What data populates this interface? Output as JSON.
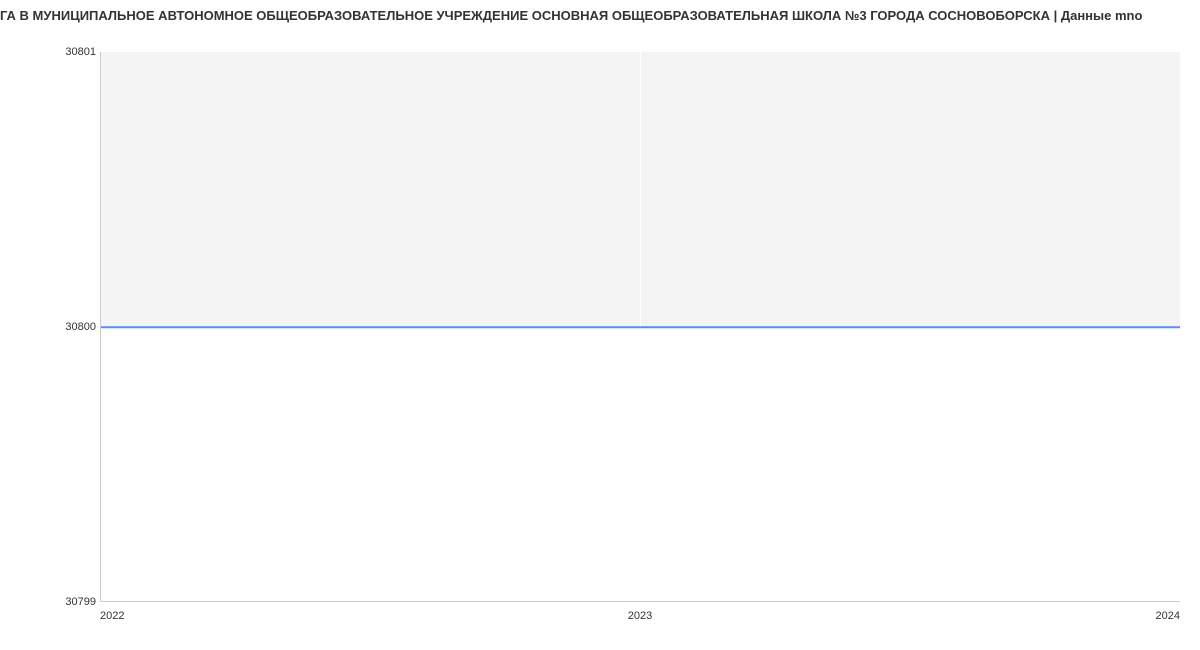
{
  "title": "ГА В МУНИЦИПАЛЬНОЕ АВТОНОМНОЕ ОБЩЕОБРАЗОВАТЕЛЬНОЕ УЧРЕЖДЕНИЕ ОСНОВНАЯ ОБЩЕОБРАЗОВАТЕЛЬНАЯ ШКОЛА №3 ГОРОДА СОСНОВОБОРСКА | Данные mno",
  "y_ticks": {
    "top": "30801",
    "mid": "30800",
    "bot": "30799"
  },
  "x_ticks": {
    "left": "2022",
    "mid": "2023",
    "right": "2024"
  },
  "chart_data": {
    "type": "line",
    "title": "ГА В МУНИЦИПАЛЬНОЕ АВТОНОМНОЕ ОБЩЕОБРАЗОВАТЕЛЬНОЕ УЧРЕЖДЕНИЕ ОСНОВНАЯ ОБЩЕОБРАЗОВАТЕЛЬНАЯ ШКОЛА №3 ГОРОДА СОСНОВОБОРСКА | Данные mno",
    "xlabel": "",
    "ylabel": "",
    "x": [
      2022,
      2023,
      2024
    ],
    "values": [
      30800,
      30800,
      30800
    ],
    "ylim": [
      30799,
      30801
    ],
    "xlim": [
      2022,
      2024
    ],
    "series": [
      {
        "name": "",
        "values": [
          30800,
          30800,
          30800
        ]
      }
    ]
  }
}
